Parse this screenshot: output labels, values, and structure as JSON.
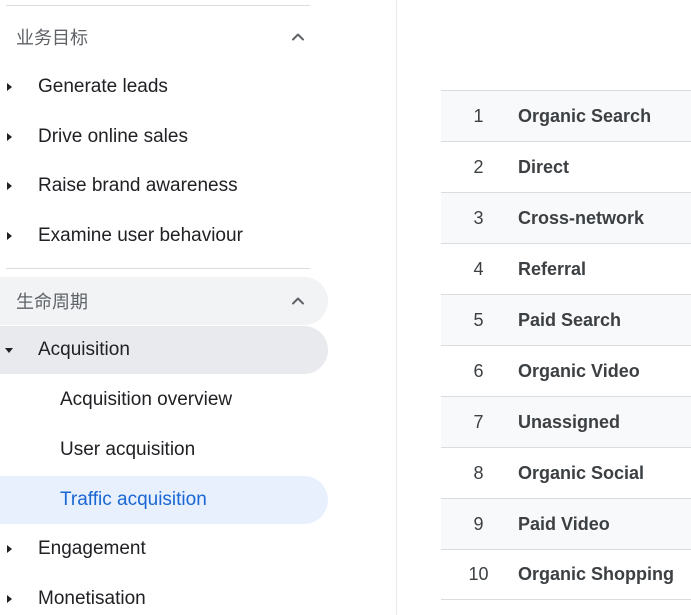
{
  "sidebar": {
    "business_objectives": {
      "title": "业务目标",
      "items": [
        {
          "label": "Generate leads"
        },
        {
          "label": "Drive online sales"
        },
        {
          "label": "Raise brand awareness"
        },
        {
          "label": "Examine user behaviour"
        }
      ]
    },
    "lifecycle": {
      "title": "生命周期",
      "acquisition": {
        "label": "Acquisition",
        "children": [
          {
            "label": "Acquisition overview"
          },
          {
            "label": "User acquisition"
          },
          {
            "label": "Traffic acquisition"
          }
        ]
      },
      "items": [
        {
          "label": "Engagement"
        },
        {
          "label": "Monetisation"
        }
      ]
    }
  },
  "table": {
    "rows": [
      {
        "index": "1",
        "label": "Organic Search"
      },
      {
        "index": "2",
        "label": "Direct"
      },
      {
        "index": "3",
        "label": "Cross-network"
      },
      {
        "index": "4",
        "label": "Referral"
      },
      {
        "index": "5",
        "label": "Paid Search"
      },
      {
        "index": "6",
        "label": "Organic Video"
      },
      {
        "index": "7",
        "label": "Unassigned"
      },
      {
        "index": "8",
        "label": "Organic Social"
      },
      {
        "index": "9",
        "label": "Paid Video"
      },
      {
        "index": "10",
        "label": "Organic Shopping"
      }
    ]
  },
  "colors": {
    "selected_bg": "#e8f0fe",
    "selected_text": "#1967d2",
    "expanded_bg": "#e8eaed",
    "divider": "#dadce0"
  }
}
